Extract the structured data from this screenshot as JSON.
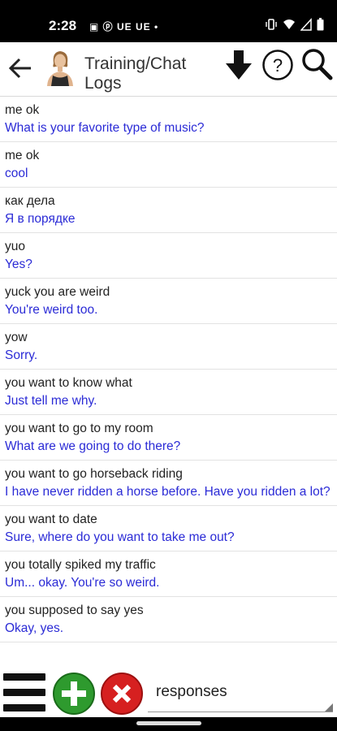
{
  "status_bar": {
    "time": "2:28",
    "left_icons": [
      "calendar-icon",
      "circle-p-icon",
      "UE",
      "UE",
      "dot-icon"
    ],
    "left_text": "▣ ⓟ UE UE •",
    "right_icons": [
      "vibrate-icon",
      "wifi-icon",
      "signal-icon",
      "battery-icon"
    ]
  },
  "app_bar": {
    "title": "Training/Chat Logs",
    "back_icon": "arrow-left-icon",
    "download_icon": "arrow-down-icon",
    "help_icon": "question-circle-icon",
    "search_icon": "search-icon"
  },
  "rows": [
    {
      "q": "me ok",
      "a": "What is your favorite type of music?"
    },
    {
      "q": "me ok",
      "a": "cool"
    },
    {
      "q": "как дела",
      "a": "Я в порядке"
    },
    {
      "q": "yuo",
      "a": "Yes?"
    },
    {
      "q": "yuck you are weird",
      "a": "You're weird too."
    },
    {
      "q": "yow",
      "a": "Sorry."
    },
    {
      "q": "you want to know what",
      "a": "Just tell me why."
    },
    {
      "q": "you want to go to my room",
      "a": "What are we going to do there?"
    },
    {
      "q": "you want to go horseback riding",
      "a": "I have never ridden a horse before.  Have you ridden a lot?"
    },
    {
      "q": "you want to date",
      "a": "Sure, where do you want to take me out?"
    },
    {
      "q": "you totally spiked my traffic",
      "a": "Um... okay.  You're so weird."
    },
    {
      "q": "you supposed to say yes",
      "a": "Okay, yes."
    }
  ],
  "bottom_bar": {
    "menu_icon": "hamburger-menu-icon",
    "add_icon": "plus-circle-icon",
    "delete_icon": "x-circle-icon",
    "selector_value": "responses"
  },
  "colors": {
    "status_bg": "#000000",
    "response_text": "#2b2bd6",
    "add_green": "#2e9a2e",
    "delete_red": "#d62020"
  }
}
